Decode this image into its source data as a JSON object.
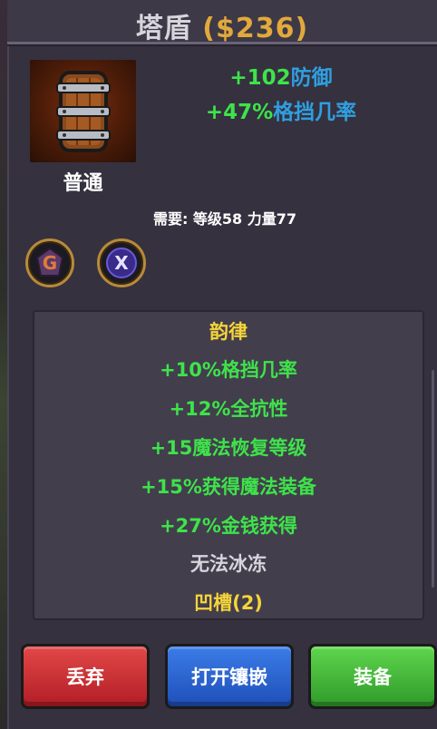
{
  "header": {
    "item_name": "塔盾",
    "price": "($236)"
  },
  "item": {
    "rarity": "普通",
    "icon": "tower-shield-icon"
  },
  "main_stats": [
    {
      "value": "+102",
      "label": "防御"
    },
    {
      "value": "+47%",
      "label": "格挡几率"
    }
  ],
  "requirements": "需要: 等级58 力量77",
  "gems": [
    {
      "icon": "rune-gem-icon",
      "glyph": "G"
    },
    {
      "icon": "arcane-gem-icon",
      "glyph": "X"
    }
  ],
  "affix_title": "韵律",
  "affixes": [
    "+10%格挡几率",
    "+12%全抗性",
    "+15魔法恢复等级",
    "+15%获得魔法装备",
    "+27%金钱获得"
  ],
  "special": "无法冰冻",
  "sockets": "凹槽(2)",
  "buttons": {
    "discard": "丢弃",
    "socket": "打开镶嵌",
    "equip": "装备"
  },
  "colors": {
    "positive": "#3ee34a",
    "stat_label": "#2f9fe0",
    "gold": "#e2a93b",
    "set_title": "#f5d43a"
  }
}
